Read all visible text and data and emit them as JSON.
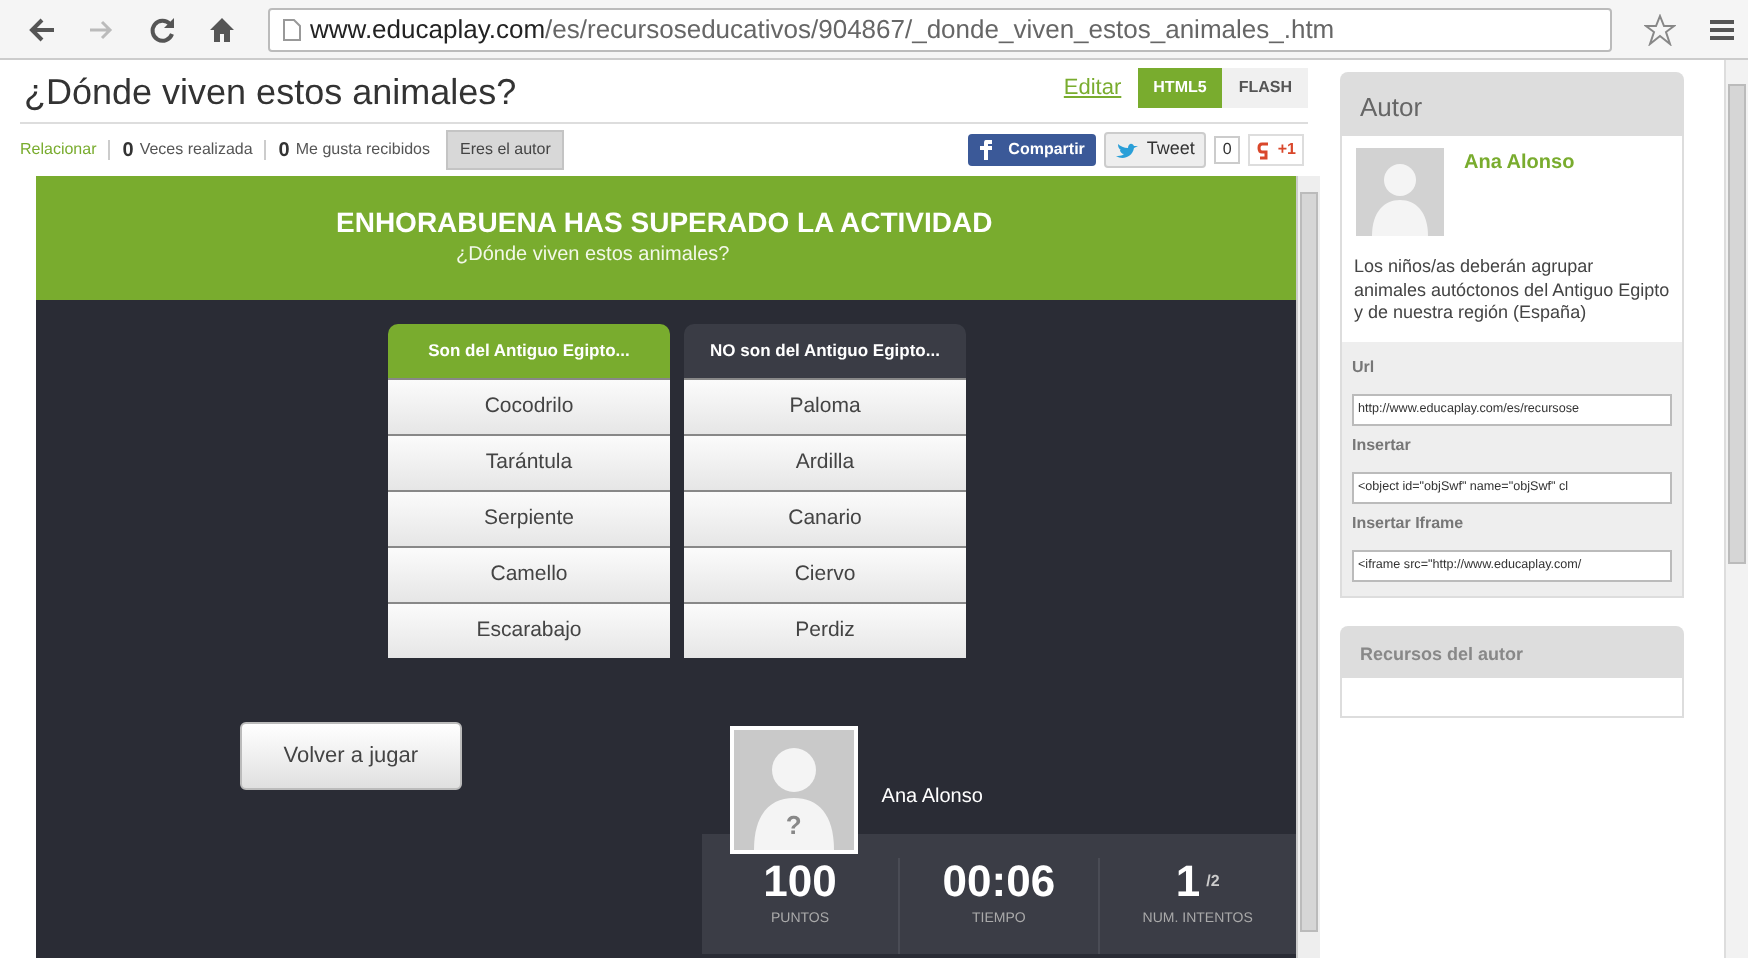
{
  "browser": {
    "url_host": "www.educaplay.com",
    "url_path": "/es/recursoseducativos/904867/_donde_viven_estos_animales_.htm"
  },
  "page": {
    "title": "¿Dónde viven estos animales?",
    "edit_link": "Editar",
    "modes": [
      {
        "label": "HTML5",
        "selected": true
      },
      {
        "label": "FLASH",
        "selected": false
      }
    ],
    "type_link": "Relacionar",
    "stats": [
      {
        "count": "0",
        "label": "Veces realizada"
      },
      {
        "count": "0",
        "label": "Me gusta recibidos"
      }
    ],
    "author_button": "Eres el autor",
    "share": {
      "facebook": "Compartir",
      "tweet": "Tweet",
      "tweet_count": "0",
      "gplus": "+1"
    }
  },
  "game": {
    "banner_title": "ENHORABUENA HAS SUPERADO LA ACTIVIDAD",
    "banner_subtitle": "¿Dónde viven estos animales?",
    "groups": [
      {
        "heading": "Son del Antiguo Egipto...",
        "selected": true,
        "items": [
          "Cocodrilo",
          "Tarántula",
          "Serpiente",
          "Camello",
          "Escarabajo"
        ]
      },
      {
        "heading": "NO son del Antiguo Egipto...",
        "selected": false,
        "items": [
          "Paloma",
          "Ardilla",
          "Canario",
          "Ciervo",
          "Perdiz"
        ]
      }
    ],
    "replay_button": "Volver a jugar",
    "player_name": "Ana Alonso",
    "avatar_mark": "?",
    "results": [
      {
        "value": "100",
        "label": "PUNTOS"
      },
      {
        "value": "00:06",
        "label": "TIEMPO"
      },
      {
        "value": "1",
        "suffix": "/2",
        "label": "NUM. INTENTOS"
      }
    ]
  },
  "sidebar": {
    "author_heading": "Autor",
    "author_name": "Ana Alonso",
    "description": "Los niños/as deberán agrupar animales autóctonos del Antiguo Egipto y de nuestra región (España)",
    "fields": [
      {
        "label": "Url",
        "value": "http://www.educaplay.com/es/recursose"
      },
      {
        "label": "Insertar",
        "value": "<object id=\"objSwf\" name=\"objSwf\" cl"
      },
      {
        "label": "Insertar Iframe",
        "value": "<iframe src=\"http://www.educaplay.com/"
      }
    ],
    "resources_heading": "Recursos del autor"
  }
}
